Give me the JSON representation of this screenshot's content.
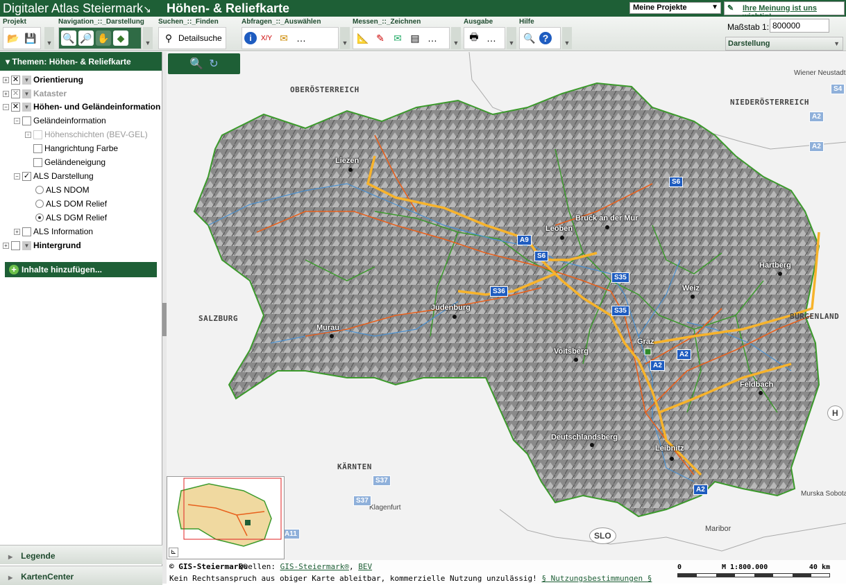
{
  "titlebar": {
    "app_title": "Digitaler Atlas Steiermark",
    "map_title": "Höhen- & Reliefkarte",
    "projects": "Meine Projekte",
    "feedback": "Ihre Meinung ist uns wichtig!"
  },
  "toolbar": {
    "groups": [
      {
        "label": "Projekt"
      },
      {
        "label": "Navigation_::_Darstellung"
      },
      {
        "label": "Suchen_::_Finden",
        "button": "Detailsuche"
      },
      {
        "label": "Abfragen_::_Auswählen"
      },
      {
        "label": "Messen_::_Zeichnen"
      },
      {
        "label": "Ausgabe"
      },
      {
        "label": "Hilfe"
      }
    ],
    "scale_label": "Maßstab 1:",
    "scale_value": "800000",
    "darstellung": "Darstellung"
  },
  "sidebar": {
    "header": "Themen: Höhen- & Reliefkarte",
    "tree": [
      "Orientierung",
      "Kataster",
      "Höhen- und Geländeinformation",
      "Geländeinformation",
      "Höhenschichten (BEV-GEL)",
      "Hangrichtung Farbe",
      "Geländeneigung",
      "ALS Darstellung",
      "ALS NDOM",
      "ALS DOM Relief",
      "ALS DGM Relief",
      "ALS Information",
      "Hintergrund"
    ],
    "add_content": "Inhalte hinzufügen...",
    "legend": "Legende",
    "kartencenter": "KartenCenter"
  },
  "map": {
    "places": [
      "Liezen",
      "Leoben",
      "Bruck an der Mur",
      "Judenburg",
      "Murau",
      "Voitsberg",
      "Graz",
      "Weiz",
      "Hartberg",
      "Feldbach",
      "Deutschlandsberg",
      "Leibnitz"
    ],
    "regions": [
      "OBERÖSTERREICH",
      "NIEDERÖSTERREICH",
      "SALZBURG",
      "BURGENLAND",
      "KÄRNTEN"
    ],
    "external": [
      "Wiener Neustadt",
      "Klagenfurt",
      "Maribor",
      "Murska Sobota",
      "SLO",
      "H"
    ],
    "shields": [
      "A9",
      "S6",
      "S36",
      "S35",
      "S35",
      "S6",
      "A2",
      "A2",
      "A2",
      "S37",
      "S37",
      "A11",
      "S4",
      "A2",
      "A2"
    ],
    "copyright": "© GIS-Steiermark®",
    "sources_label": "Quellen:",
    "source_1": "GIS-Steiermark®",
    "source_2": "BEV",
    "disclaimer": "Kein Rechtsanspruch aus obiger Karte ableitbar, kommerzielle Nutzung unzulässig!",
    "terms": "§ Nutzungsbestimmungen §",
    "scale_text": "M 1:800.000",
    "scale_start": "0",
    "scale_end": "40 km"
  }
}
